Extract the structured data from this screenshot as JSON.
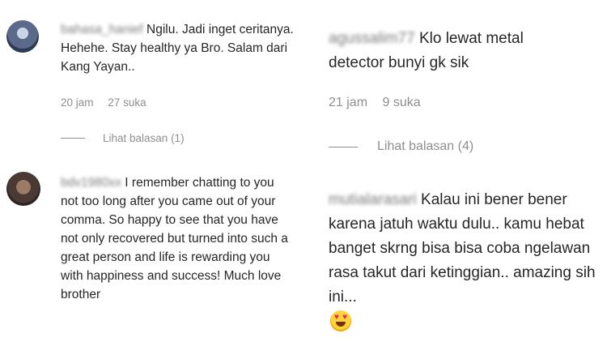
{
  "comments_left": [
    {
      "username": "bahasa_hanief",
      "body": "Ngilu. Jadi inget ceritanya. Hehehe. Stay healthy ya Bro. Salam dari Kang Yayan..",
      "time": "20 jam",
      "likes": "27 suka",
      "replies": "Lihat balasan (1)"
    },
    {
      "username": "bdv1980xx",
      "body": "I remember chatting to you not too long after you came out of your comma. So happy to see that you have not only recovered but turned into such a great person and life is rewarding you with happiness and success! Much love brother"
    }
  ],
  "comments_right": [
    {
      "username": "agussalim77",
      "body": "Klo lewat metal detector bunyi gk sik",
      "time": "21 jam",
      "likes": "9 suka",
      "replies": "Lihat balasan (4)"
    },
    {
      "username": "mutialarasari",
      "body": "Kalau ini bener bener karena jatuh waktu dulu.. kamu hebat banget skrng bisa bisa coba ngelawan rasa takut dari ketinggian.. amazing sih ini...",
      "emoji": "heart-eyes-emoji"
    }
  ]
}
